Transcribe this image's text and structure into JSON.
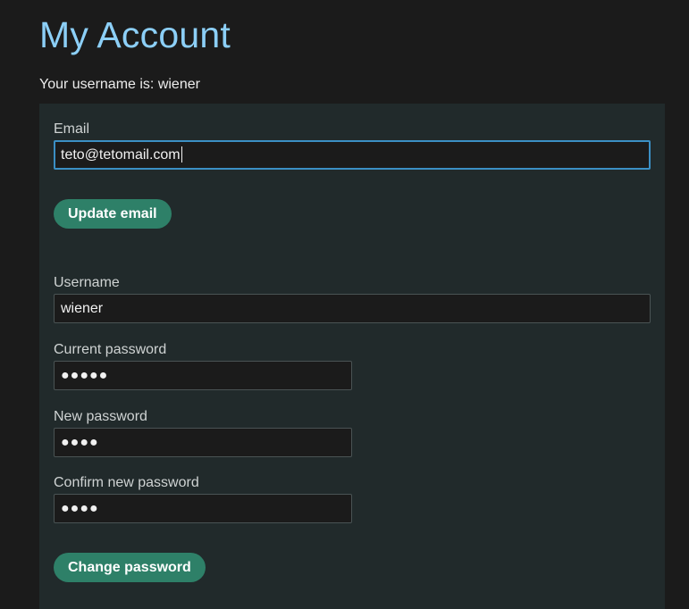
{
  "page": {
    "title": "My Account",
    "username_line": "Your username is: wiener"
  },
  "email_form": {
    "email_label": "Email",
    "email_value": "teto@tetomail.com",
    "update_button": "Update email"
  },
  "password_form": {
    "username_label": "Username",
    "username_value": "wiener",
    "current_password_label": "Current password",
    "current_password_mask": "●●●●●",
    "new_password_label": "New password",
    "new_password_mask": "●●●●",
    "confirm_password_label": "Confirm new password",
    "confirm_password_mask": "●●●●",
    "change_button": "Change password"
  },
  "colors": {
    "background": "#1b1b1b",
    "panel": "#212a2b",
    "title": "#8ccff7",
    "button": "#2e8068",
    "focus_border": "#3b8fc4"
  }
}
